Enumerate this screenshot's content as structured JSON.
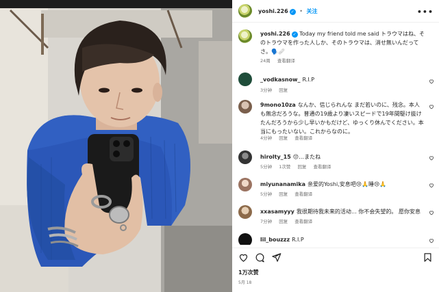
{
  "post": {
    "username": "yoshi.226",
    "separator": "•",
    "follow_label": "关注",
    "more_icon": "more-horizontal-icon"
  },
  "caption": {
    "username": "yoshi.226",
    "text": "Today my friend told me said トラウマはね、そのトラウマを作った人しか、そのトラウマは、消せ無いんだってさ。",
    "emoji": "🗣️🩹",
    "time": "24周",
    "translate": "查看翻译"
  },
  "comments": [
    {
      "username": "_vodkasnow_",
      "text": "R.I.P",
      "time": "3分钟",
      "reply": "回复",
      "translate": "",
      "likes": "",
      "avatar_color": "#1f4d3a"
    },
    {
      "username": "9mono10za",
      "text": "なんか、信じられんな まだ若いのに、残念。本人も無念だろうな。普通の19歳より凄いスピードで19年間駆け抜けたんだろうから少し早いかもだけど、ゆっくり休んでください。本当にもったいない。これからなのに。",
      "time": "4分钟",
      "reply": "回复",
      "translate": "查看翻译",
      "likes": "",
      "avatar_color": "#8a6f5a"
    },
    {
      "username": "hirolty_15",
      "text": "😔…またね",
      "time": "5分钟",
      "reply": "回复",
      "translate": "查看翻译",
      "likes": "1次赞",
      "avatar_color": "#3a3a3a"
    },
    {
      "username": "miyunanamika",
      "text": "亲爱的Yoshi,安息吧😢🙏睡😢🙏",
      "time": "5分钟",
      "reply": "回复",
      "translate": "查看翻译",
      "likes": "",
      "avatar_color": "#b08a7a"
    },
    {
      "username": "xxasamyyy",
      "text": "我很期待我未来的活动… 你不会失望的。 愿你安息",
      "time": "7分钟",
      "reply": "回复",
      "translate": "查看翻译",
      "likes": "",
      "avatar_color": "#9a7a5a"
    },
    {
      "username": "lil_bouzzz",
      "text": "R.I.P",
      "time": "",
      "reply": "",
      "translate": "",
      "likes": "",
      "avatar_color": "#111111"
    }
  ],
  "actions": {
    "like_icon": "heart-icon",
    "comment_icon": "comment-icon",
    "share_icon": "send-icon",
    "save_icon": "bookmark-icon"
  },
  "likes_text": "1万次赞",
  "date_text": "5月 18"
}
